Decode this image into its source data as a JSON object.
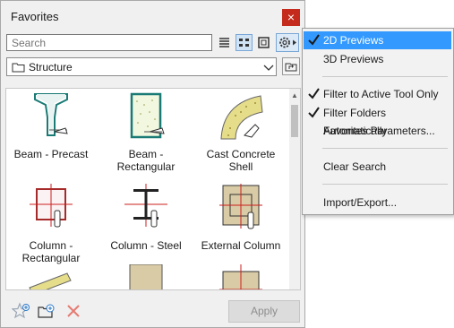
{
  "panel": {
    "title": "Favorites",
    "close_label": "×",
    "search_placeholder": "Search",
    "folder_label": "Structure",
    "apply_label": "Apply"
  },
  "items": [
    {
      "label": "Beam - Precast",
      "icon": "beam-precast-icon"
    },
    {
      "label": "Beam - Rectangular",
      "icon": "beam-rectangular-icon"
    },
    {
      "label": "Cast Concrete Shell",
      "icon": "shell-icon"
    },
    {
      "label": "Column - Rectangular",
      "icon": "column-rectangular-icon"
    },
    {
      "label": "Column - Steel",
      "icon": "column-steel-icon"
    },
    {
      "label": "External Column",
      "icon": "external-column-icon"
    }
  ],
  "menu": {
    "items": [
      {
        "label": "2D Previews",
        "checked": true,
        "highlighted": true
      },
      {
        "label": "3D Previews",
        "checked": false
      },
      {
        "label": "Filter to Active Tool Only",
        "checked": true
      },
      {
        "label": "Filter Folders Automatically",
        "checked": true
      },
      {
        "label": "Favorites Parameters...",
        "checked": false
      },
      {
        "label": "Clear Search",
        "checked": false
      },
      {
        "label": "Import/Export...",
        "checked": false
      }
    ]
  },
  "colors": {
    "accent": "#3399ff",
    "close": "#c42b1c",
    "concrete": "#d9cba6",
    "teal": "#1a7a75",
    "red_guide": "#cc1f1f"
  }
}
